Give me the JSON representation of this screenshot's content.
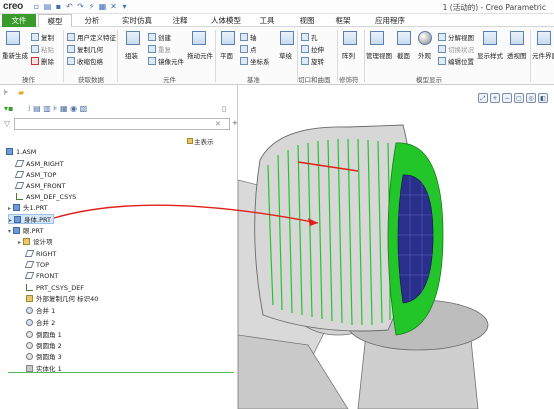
{
  "app": {
    "logo": "creo",
    "window_title": "1 (活动的) - Creo Parametric"
  },
  "tabs": [
    "文件",
    "模型",
    "分析",
    "实时仿真",
    "注释",
    "人体模型",
    "工具",
    "视图",
    "框架",
    "应用程序"
  ],
  "active_tab": "模型",
  "ribbon": {
    "items": {
      "regen": "重新生成",
      "copy": "复制",
      "paste": "粘贴",
      "delete": "删除",
      "udf": "用户定义特征",
      "copy_geom": "复制几何",
      "shrinkwrap": "收缩包络",
      "create": "创建",
      "reuse": "重复",
      "mirror_comp": "镜像元件",
      "assemble": "组装",
      "drag": "拖动元件",
      "plane": "平面",
      "axis": "轴",
      "point": "点",
      "csys": "坐标系",
      "sketch": "草绘",
      "hole": "孔",
      "extrude": "拉伸",
      "revolve": "旋转",
      "pattern": "阵列",
      "manage_views": "管理视图",
      "section": "截面",
      "appearance": "外观",
      "explode": "分解视图",
      "toggle_state": "切换状况",
      "edit_pos": "编辑位置",
      "display_style": "显示样式",
      "perspective": "透视图",
      "interface": "元件界面"
    },
    "groups": {
      "operations": "操作",
      "get_data": "获取数据",
      "component": "元件",
      "datum": "基准",
      "cut_surface": "切口和曲面",
      "modifiers": "修饰符",
      "model_display": "模型显示"
    }
  },
  "tree": {
    "search_placeholder": "",
    "main_display": "主表示",
    "items": [
      {
        "label": "1.ASM",
        "icon": "assembly-icon"
      },
      {
        "label": "ASM_RIGHT",
        "icon": "datum-plane-icon"
      },
      {
        "label": "ASM_TOP",
        "icon": "datum-plane-icon"
      },
      {
        "label": "ASM_FRONT",
        "icon": "datum-plane-icon"
      },
      {
        "label": "ASM_DEF_CSYS",
        "icon": "csys-icon"
      },
      {
        "label": "头1.PRT",
        "icon": "part-icon"
      },
      {
        "label": "身体.PRT",
        "icon": "part-icon"
      },
      {
        "label": "眼.PRT",
        "icon": "part-icon"
      },
      {
        "label": "设计项",
        "icon": "design-item-icon"
      },
      {
        "label": "RIGHT",
        "icon": "datum-plane-icon"
      },
      {
        "label": "TOP",
        "icon": "datum-plane-icon"
      },
      {
        "label": "FRONT",
        "icon": "datum-plane-icon"
      },
      {
        "label": "PRT_CSYS_DEF",
        "icon": "csys-icon"
      },
      {
        "label": "外部复制几何 标识40",
        "icon": "external-copy-icon"
      },
      {
        "label": "合并 1",
        "icon": "merge-icon"
      },
      {
        "label": "合并 2",
        "icon": "merge-icon"
      },
      {
        "label": "倒圆角 1",
        "icon": "round-icon"
      },
      {
        "label": "倒圆角 2",
        "icon": "round-icon"
      },
      {
        "label": "倒圆角 3",
        "icon": "round-icon"
      },
      {
        "label": "实体化 1",
        "icon": "solidify-icon"
      }
    ]
  },
  "colors": {
    "file_tab": "#3a9b2c",
    "green_surface": "#22c629",
    "annotation_red": "#e0201b",
    "highlight": "#d4e6fa"
  }
}
